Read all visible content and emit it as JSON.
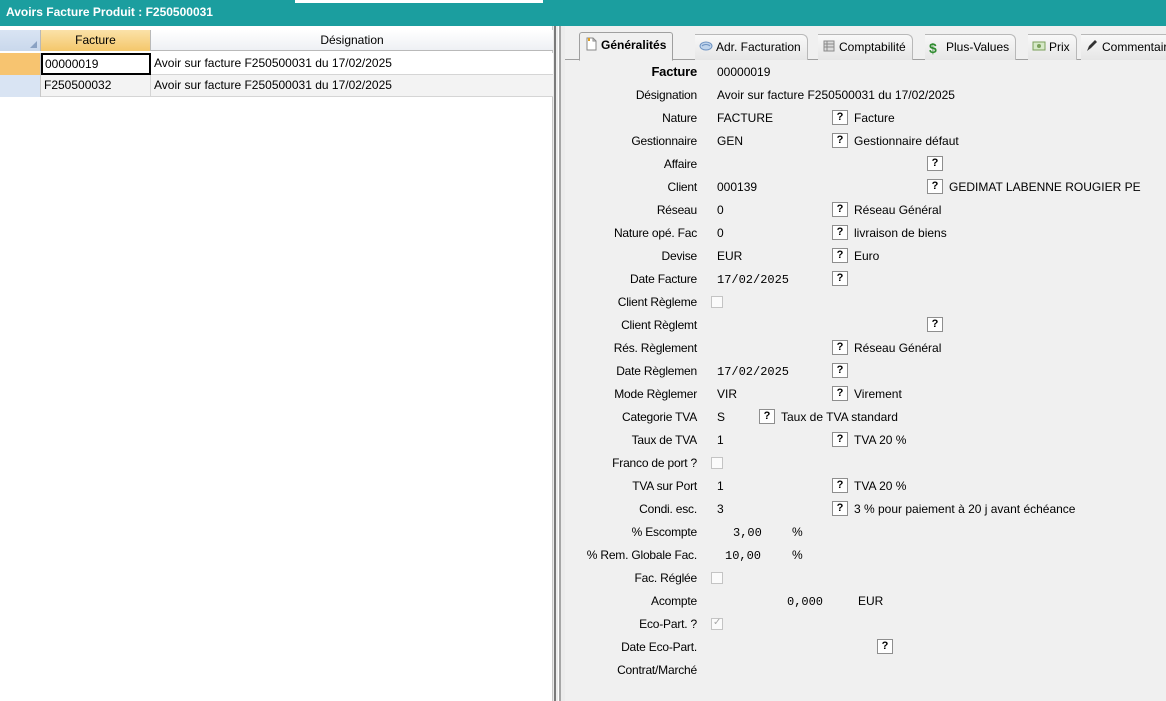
{
  "window": {
    "title": "Avoirs Facture Produit : F250500031"
  },
  "grid": {
    "headers": [
      "Facture",
      "Désignation"
    ],
    "rows": [
      {
        "facture": "00000019",
        "designation": "Avoir sur facture F250500031 du 17/02/2025"
      },
      {
        "facture": "F250500032",
        "designation": "Avoir sur facture F250500031 du 17/02/2025"
      }
    ]
  },
  "tabs": [
    {
      "label": "Généralités"
    },
    {
      "label": "Adr. Facturation"
    },
    {
      "label": "Comptabilité"
    },
    {
      "label": "Plus-Values"
    },
    {
      "label": "Prix"
    },
    {
      "label": "Commentaire"
    }
  ],
  "form": {
    "facture": {
      "label": "Facture",
      "value": "00000019"
    },
    "designation": {
      "label": "Désignation",
      "value": "Avoir sur facture F250500031 du 17/02/2025"
    },
    "nature": {
      "label": "Nature",
      "value": "FACTURE",
      "lookup": "Facture"
    },
    "gestionnaire": {
      "label": "Gestionnaire",
      "value": "GEN",
      "lookup": "Gestionnaire défaut"
    },
    "affaire": {
      "label": "Affaire",
      "value": ""
    },
    "client": {
      "label": "Client",
      "value": "000139",
      "lookup": "GEDIMAT LABENNE ROUGIER PE"
    },
    "reseau": {
      "label": "Réseau",
      "value": "0",
      "lookup": "Réseau Général"
    },
    "nature_ope": {
      "label": "Nature opé. Fac",
      "value": "0",
      "lookup": "livraison de biens"
    },
    "devise": {
      "label": "Devise",
      "value": "EUR",
      "lookup": "Euro"
    },
    "date_facture": {
      "label": "Date Facture",
      "value": "17/02/2025"
    },
    "client_regleme": {
      "label": "Client Règleme",
      "checked": false
    },
    "client_reglemt": {
      "label": "Client Règlemt",
      "value": ""
    },
    "res_reglement": {
      "label": "Rés. Règlement",
      "lookup": "Réseau Général"
    },
    "date_reglemen": {
      "label": "Date Règlemen",
      "value": "17/02/2025"
    },
    "mode_reglemer": {
      "label": "Mode Règlemer",
      "value": "VIR",
      "lookup": "Virement"
    },
    "categorie_tva": {
      "label": "Categorie TVA",
      "value": "S",
      "lookup": "Taux de TVA standard"
    },
    "taux_tva": {
      "label": "Taux de TVA",
      "value": "1",
      "lookup": "TVA 20 %"
    },
    "franco_port": {
      "label": "Franco de port ?",
      "checked": false
    },
    "tva_port": {
      "label": "TVA sur Port",
      "value": "1",
      "lookup": "TVA 20 %"
    },
    "condi_esc": {
      "label": "Condi. esc.",
      "value": "3",
      "lookup": "3 % pour paiement à 20 j avant échéance"
    },
    "pct_escompte": {
      "label": "% Escompte",
      "value": "3,00",
      "unit": "%"
    },
    "pct_rem_globale": {
      "label": "% Rem. Globale Fac.",
      "value": "10,00",
      "unit": "%"
    },
    "fac_reglee": {
      "label": "Fac. Réglée",
      "checked": false
    },
    "acompte": {
      "label": "Acompte",
      "value": "0,000",
      "unit": "EUR"
    },
    "eco_part": {
      "label": "Eco-Part. ?",
      "checked": true
    },
    "date_eco_part": {
      "label": "Date Eco-Part.",
      "value": ""
    },
    "contrat_marche": {
      "label": "Contrat/Marché",
      "value": ""
    }
  },
  "ui": {
    "lookup_button_label": "?"
  },
  "colors": {
    "titlebar": "#1b9e9f",
    "selected_header": "#f4c76b",
    "row_selector": "#f7c470"
  }
}
